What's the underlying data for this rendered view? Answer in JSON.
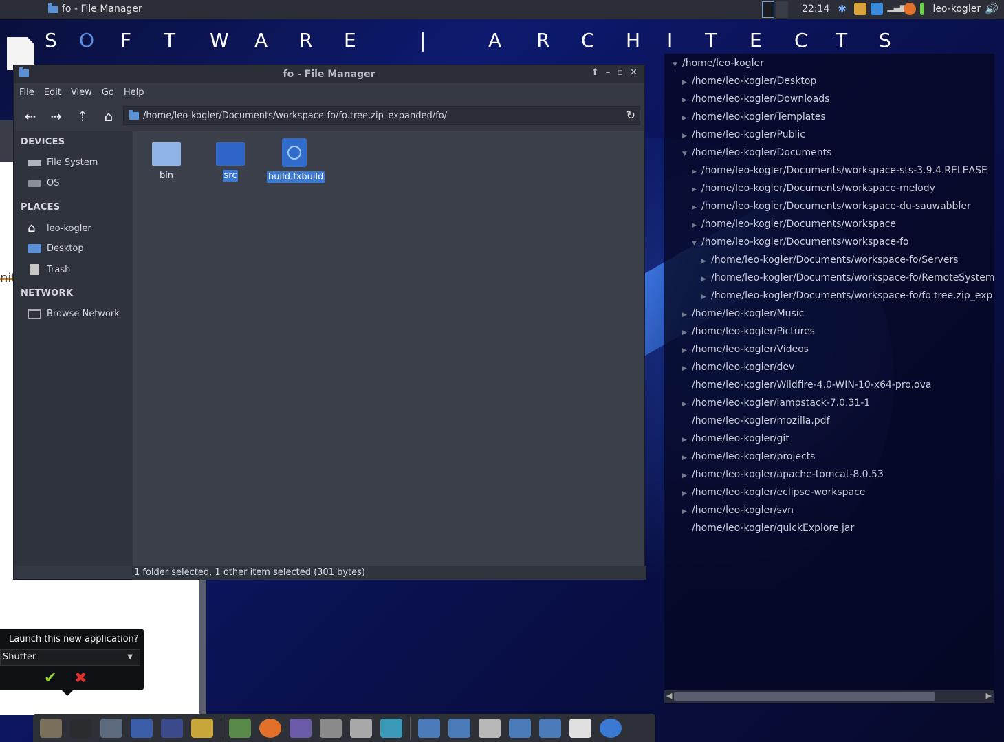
{
  "top_panel": {
    "task_title": "fo - File Manager",
    "clock": "22:14",
    "user": "leo-kogler"
  },
  "banner": {
    "letters": [
      "S",
      "O",
      "F",
      "T",
      "W",
      "A",
      "R",
      "E",
      "|",
      "A",
      "R",
      "C",
      "H",
      "I",
      "T",
      "E",
      "C",
      "T",
      "S"
    ]
  },
  "file_manager": {
    "title": "fo - File Manager",
    "menu": [
      "File",
      "Edit",
      "View",
      "Go",
      "Help"
    ],
    "address": "/home/leo-kogler/Documents/workspace-fo/fo.tree.zip_expanded/fo/",
    "sidebar": {
      "devices_header": "DEVICES",
      "devices": [
        "File System",
        "OS"
      ],
      "places_header": "PLACES",
      "places": [
        "leo-kogler",
        "Desktop",
        "Trash"
      ],
      "network_header": "NETWORK",
      "network": [
        "Browse Network"
      ]
    },
    "items": [
      {
        "name": "bin",
        "type": "folder",
        "selected": false
      },
      {
        "name": "src",
        "type": "folder",
        "selected": true
      },
      {
        "name": "build.fxbuild",
        "type": "file",
        "selected": true
      }
    ],
    "status": "1 folder selected, 1 other item selected (301 bytes)"
  },
  "tree": [
    {
      "label": "/home/leo-kogler",
      "indent": 0,
      "arrow": "down"
    },
    {
      "label": "/home/leo-kogler/Desktop",
      "indent": 1,
      "arrow": "right"
    },
    {
      "label": "/home/leo-kogler/Downloads",
      "indent": 1,
      "arrow": "right"
    },
    {
      "label": "/home/leo-kogler/Templates",
      "indent": 1,
      "arrow": "right"
    },
    {
      "label": "/home/leo-kogler/Public",
      "indent": 1,
      "arrow": "right"
    },
    {
      "label": "/home/leo-kogler/Documents",
      "indent": 1,
      "arrow": "down"
    },
    {
      "label": "/home/leo-kogler/Documents/workspace-sts-3.9.4.RELEASE",
      "indent": 2,
      "arrow": "right"
    },
    {
      "label": "/home/leo-kogler/Documents/workspace-melody",
      "indent": 2,
      "arrow": "right"
    },
    {
      "label": "/home/leo-kogler/Documents/workspace-du-sauwabbler",
      "indent": 2,
      "arrow": "right"
    },
    {
      "label": "/home/leo-kogler/Documents/workspace",
      "indent": 2,
      "arrow": "right"
    },
    {
      "label": "/home/leo-kogler/Documents/workspace-fo",
      "indent": 2,
      "arrow": "down"
    },
    {
      "label": "/home/leo-kogler/Documents/workspace-fo/Servers",
      "indent": 3,
      "arrow": "right"
    },
    {
      "label": "/home/leo-kogler/Documents/workspace-fo/RemoteSystem",
      "indent": 3,
      "arrow": "right"
    },
    {
      "label": "/home/leo-kogler/Documents/workspace-fo/fo.tree.zip_exp",
      "indent": 3,
      "arrow": "right"
    },
    {
      "label": "/home/leo-kogler/Music",
      "indent": 1,
      "arrow": "right"
    },
    {
      "label": "/home/leo-kogler/Pictures",
      "indent": 1,
      "arrow": "right"
    },
    {
      "label": "/home/leo-kogler/Videos",
      "indent": 1,
      "arrow": "right"
    },
    {
      "label": "/home/leo-kogler/dev",
      "indent": 1,
      "arrow": "right"
    },
    {
      "label": "/home/leo-kogler/Wildfire-4.0-WIN-10-x64-pro.ova",
      "indent": 1,
      "arrow": "none"
    },
    {
      "label": "/home/leo-kogler/lampstack-7.0.31-1",
      "indent": 1,
      "arrow": "right"
    },
    {
      "label": "/home/leo-kogler/mozilla.pdf",
      "indent": 1,
      "arrow": "none"
    },
    {
      "label": "/home/leo-kogler/git",
      "indent": 1,
      "arrow": "right"
    },
    {
      "label": "/home/leo-kogler/projects",
      "indent": 1,
      "arrow": "right"
    },
    {
      "label": "/home/leo-kogler/apache-tomcat-8.0.53",
      "indent": 1,
      "arrow": "right"
    },
    {
      "label": "/home/leo-kogler/eclipse-workspace",
      "indent": 1,
      "arrow": "right"
    },
    {
      "label": "/home/leo-kogler/svn",
      "indent": 1,
      "arrow": "right"
    },
    {
      "label": "/home/leo-kogler/quickExplore.jar",
      "indent": 1,
      "arrow": "none"
    }
  ],
  "launch_popup": {
    "question": "Launch this new application?",
    "selected_app": "Shutter"
  },
  "background_app": {
    "partial_text": "nit"
  },
  "dock_icons": [
    "gimp-icon",
    "terminal-icon",
    "wireshark-icon",
    "calculator-icon",
    "arduino-icon",
    "game-icon",
    "mail-icon",
    "firefox-icon",
    "pidgin-icon",
    "help-icon",
    "installer-icon",
    "browser-icon",
    "home-folder-icon",
    "documents-folder-icon",
    "search-icon",
    "downloads-folder-icon",
    "pictures-folder-icon",
    "usb-icon",
    "accessibility-icon"
  ],
  "colors": {
    "selection": "#3a78d4",
    "panel_bg": "#2b2e37",
    "fm_bg": "#3b404b"
  }
}
